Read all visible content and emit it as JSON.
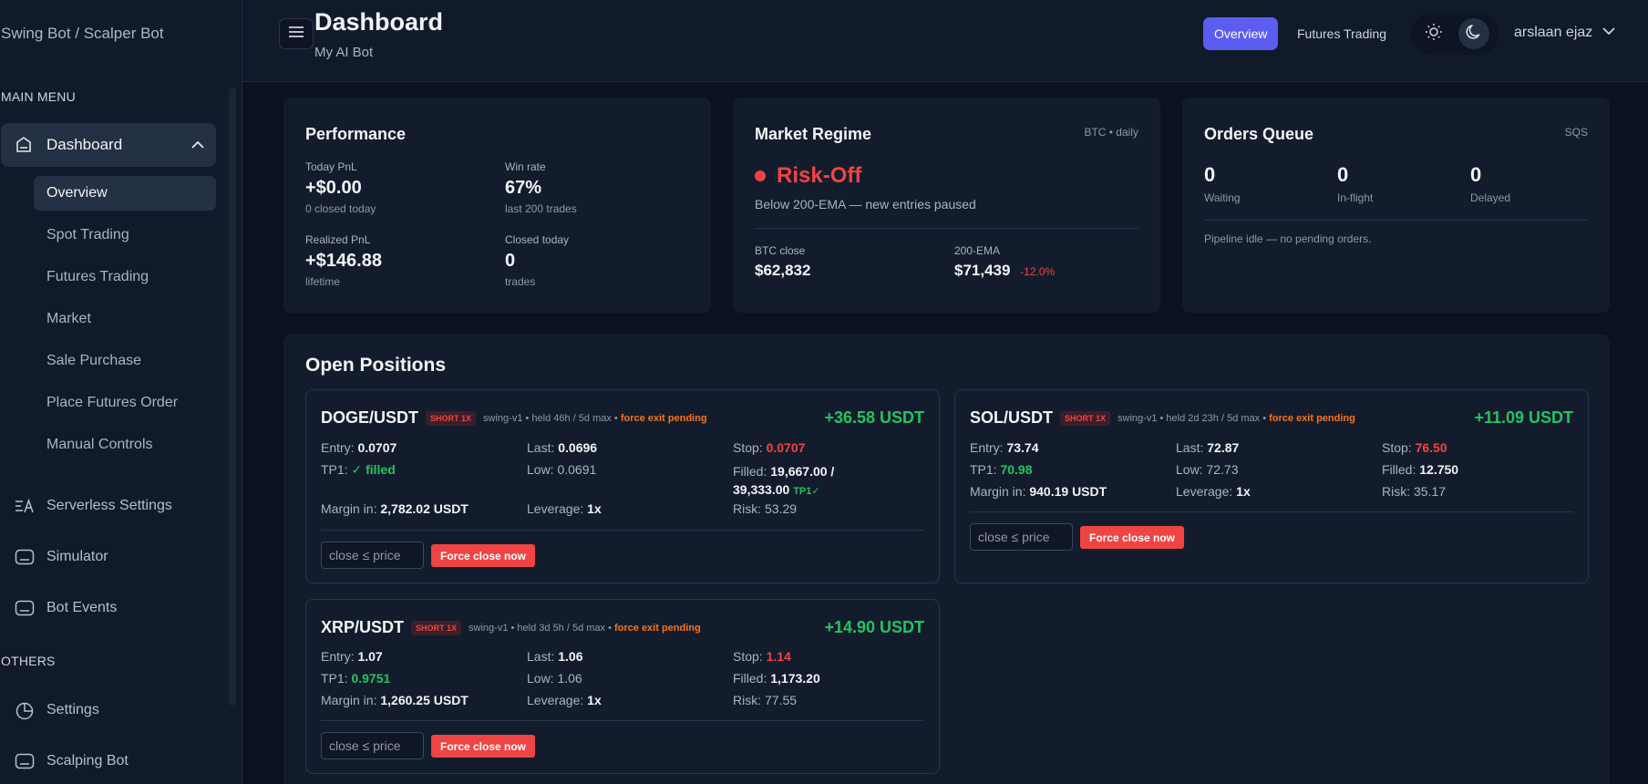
{
  "sidebar": {
    "brand": "Swing Bot / Scalper Bot",
    "main_menu_label": "MAIN MENU",
    "others_label": "OTHERS",
    "dashboard_label": "Dashboard",
    "sub_items": [
      "Overview",
      "Spot Trading",
      "Futures Trading",
      "Market",
      "Sale Purchase",
      "Place Futures Order",
      "Manual Controls"
    ],
    "items": [
      "Serverless Settings",
      "Simulator",
      "Bot Events"
    ],
    "other_items": [
      "Settings",
      "Scalping Bot"
    ]
  },
  "header": {
    "title": "Dashboard",
    "subtitle": "My AI Bot",
    "tabs": [
      "Overview",
      "Futures Trading"
    ],
    "user": "arslaan ejaz"
  },
  "performance": {
    "title": "Performance",
    "today_pnl_label": "Today PnL",
    "today_pnl": "+$0.00",
    "today_pnl_sub": "0 closed today",
    "win_rate_label": "Win rate",
    "win_rate": "67%",
    "win_rate_sub": "last 200 trades",
    "realized_label": "Realized PnL",
    "realized": "+$146.88",
    "realized_sub": "lifetime",
    "closed_label": "Closed today",
    "closed": "0",
    "closed_sub": "trades"
  },
  "regime": {
    "title": "Market Regime",
    "tag": "BTC • daily",
    "state": "Risk-Off",
    "desc": "Below 200-EMA — new entries paused",
    "btc_close_label": "BTC close",
    "btc_close": "$62,832",
    "ema_label": "200-EMA",
    "ema": "$71,439",
    "ema_delta": "-12.0%"
  },
  "queue": {
    "title": "Orders Queue",
    "tag": "SQS",
    "waiting": "0",
    "waiting_label": "Waiting",
    "inflight": "0",
    "inflight_label": "In-flight",
    "delayed": "0",
    "delayed_label": "Delayed",
    "idle": "Pipeline idle — no pending orders."
  },
  "open_positions": {
    "title": "Open Positions",
    "close_placeholder": "close ≤ price",
    "force_label": "Force close now",
    "labels": {
      "entry": "Entry:",
      "last": "Last:",
      "stop": "Stop:",
      "tp1": "TP1:",
      "low": "Low:",
      "filled": "Filled:",
      "margin": "Margin in:",
      "leverage": "Leverage:",
      "risk": "Risk:"
    },
    "positions": [
      {
        "symbol": "DOGE/USDT",
        "badge": "SHORT 1X",
        "meta": "swing-v1 • held 46h / 5d max • ",
        "warn": "force exit pending",
        "pnl": "+36.58 USDT",
        "entry": "0.0707",
        "last": "0.0696",
        "stop": "0.0707",
        "tp1": "✓ filled",
        "low": "0.0691",
        "filled": "19,667.00 /",
        "filled2": "39,333.00",
        "filled_tag": "TP1✓",
        "margin": "2,782.02 USDT",
        "leverage": "1x",
        "risk": "53.29"
      },
      {
        "symbol": "SOL/USDT",
        "badge": "SHORT 1X",
        "meta": "swing-v1 • held 2d 23h / 5d max • ",
        "warn": "force exit pending",
        "pnl": "+11.09 USDT",
        "entry": "73.74",
        "last": "72.87",
        "stop": "76.50",
        "tp1": "70.98",
        "low": "72.73",
        "filled": "12.750",
        "margin": "940.19 USDT",
        "leverage": "1x",
        "risk": "35.17"
      },
      {
        "symbol": "XRP/USDT",
        "badge": "SHORT 1X",
        "meta": "swing-v1 • held 3d 5h / 5d max • ",
        "warn": "force exit pending",
        "pnl": "+14.90 USDT",
        "entry": "1.07",
        "last": "1.06",
        "stop": "1.14",
        "tp1": "0.9751",
        "low": "1.06",
        "filled": "1,173.20",
        "margin": "1,260.25 USDT",
        "leverage": "1x",
        "risk": "77.55"
      }
    ]
  },
  "colors": {
    "accent": "#5b5cf0",
    "danger": "#ef4444",
    "success": "#22c55e",
    "warn": "#f97316"
  }
}
